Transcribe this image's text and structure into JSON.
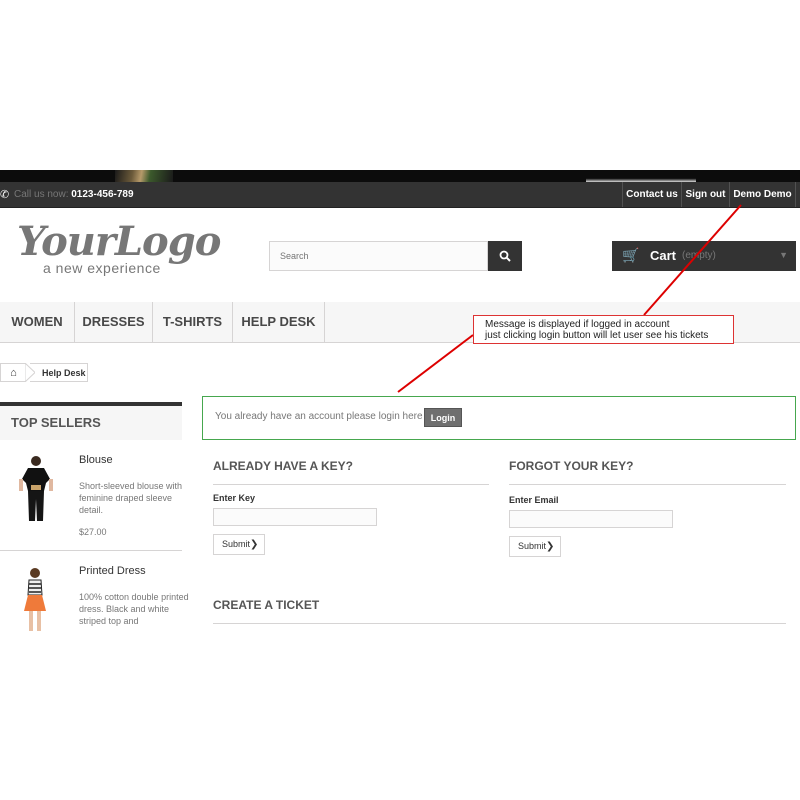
{
  "header": {
    "call_label": "Call us now:",
    "phone": "0123-456-789",
    "links": [
      "Contact us",
      "Sign out",
      "Demo Demo"
    ]
  },
  "logo": {
    "brand": "YourLogo",
    "tagline": "a new experience"
  },
  "search": {
    "placeholder": "Search"
  },
  "cart": {
    "label": "Cart",
    "status": "(empty)"
  },
  "menu": [
    "WOMEN",
    "DRESSES",
    "T-SHIRTS",
    "HELP DESK"
  ],
  "breadcrumb": {
    "current": "Help Desk"
  },
  "sidebar": {
    "title": "TOP SELLERS",
    "products": [
      {
        "name": "Blouse",
        "description": "Short-sleeved blouse with feminine draped sleeve detail.",
        "price": "$27.00"
      },
      {
        "name": "Printed Dress",
        "description": "100% cotton double printed dress. Black and white striped top and"
      }
    ]
  },
  "login_alert": {
    "message": "You already have an account please login here",
    "button": "Login"
  },
  "already_have_key": {
    "title": "ALREADY HAVE A KEY?",
    "label": "Enter Key",
    "submit": "Submit"
  },
  "forgot_key": {
    "title": "FORGOT YOUR KEY?",
    "label": "Enter Email",
    "submit": "Submit"
  },
  "create_ticket": {
    "title": "CREATE A TICKET"
  },
  "annotation": {
    "line1": "Message is displayed if logged in account",
    "line2": "just clicking login button will let user see his tickets"
  },
  "colors": {
    "dark": "#333333",
    "alert_border": "#46a74e",
    "annotation": "#dd0000"
  },
  "icons": [
    "phone-icon",
    "search-icon",
    "cart-icon",
    "home-icon",
    "chevron-right-icon"
  ]
}
